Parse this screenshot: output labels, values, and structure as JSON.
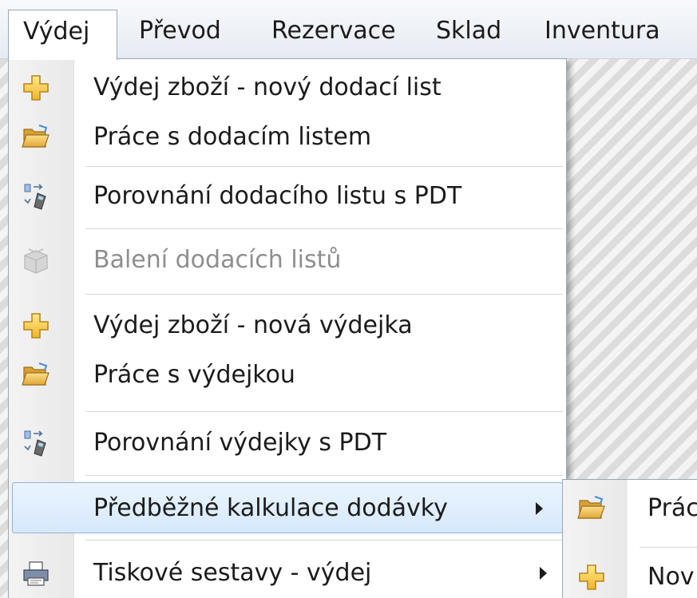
{
  "menubar": {
    "items": [
      {
        "label": "Výdej"
      },
      {
        "label": "Převod"
      },
      {
        "label": "Rezervace"
      },
      {
        "label": "Sklad"
      },
      {
        "label": "Inventura"
      }
    ]
  },
  "dropdown": {
    "items": [
      {
        "label": "Výdej zboží - nový dodací list",
        "icon": "plus-icon"
      },
      {
        "label": "Práce s dodacím listem",
        "icon": "folder-open-icon"
      },
      {
        "label": "Porovnání dodacího listu s PDT",
        "icon": "compare-pdt-icon"
      },
      {
        "label": "Balení dodacích listů",
        "icon": "package-icon",
        "disabled": true
      },
      {
        "label": "Výdej zboží - nová výdejka",
        "icon": "plus-icon"
      },
      {
        "label": "Práce s výdejkou",
        "icon": "folder-open-icon"
      },
      {
        "label": "Porovnání výdejky s PDT",
        "icon": "compare-pdt-icon"
      },
      {
        "label": "Předběžné kalkulace dodávky",
        "icon": "",
        "submenu": true,
        "highlighted": true
      },
      {
        "label": "Tiskové sestavy - výdej",
        "icon": "printer-icon",
        "submenu": true
      }
    ]
  },
  "submenu": {
    "items": [
      {
        "label": "Prác",
        "icon": "folder-open-icon"
      },
      {
        "label": "Nov",
        "icon": "plus-icon"
      }
    ]
  },
  "colors": {
    "highlight_border": "#8fb4dd",
    "plus_icon": "#f2c230",
    "folder_icon": "#e9b84a",
    "disabled_text": "#8e8e8e"
  }
}
